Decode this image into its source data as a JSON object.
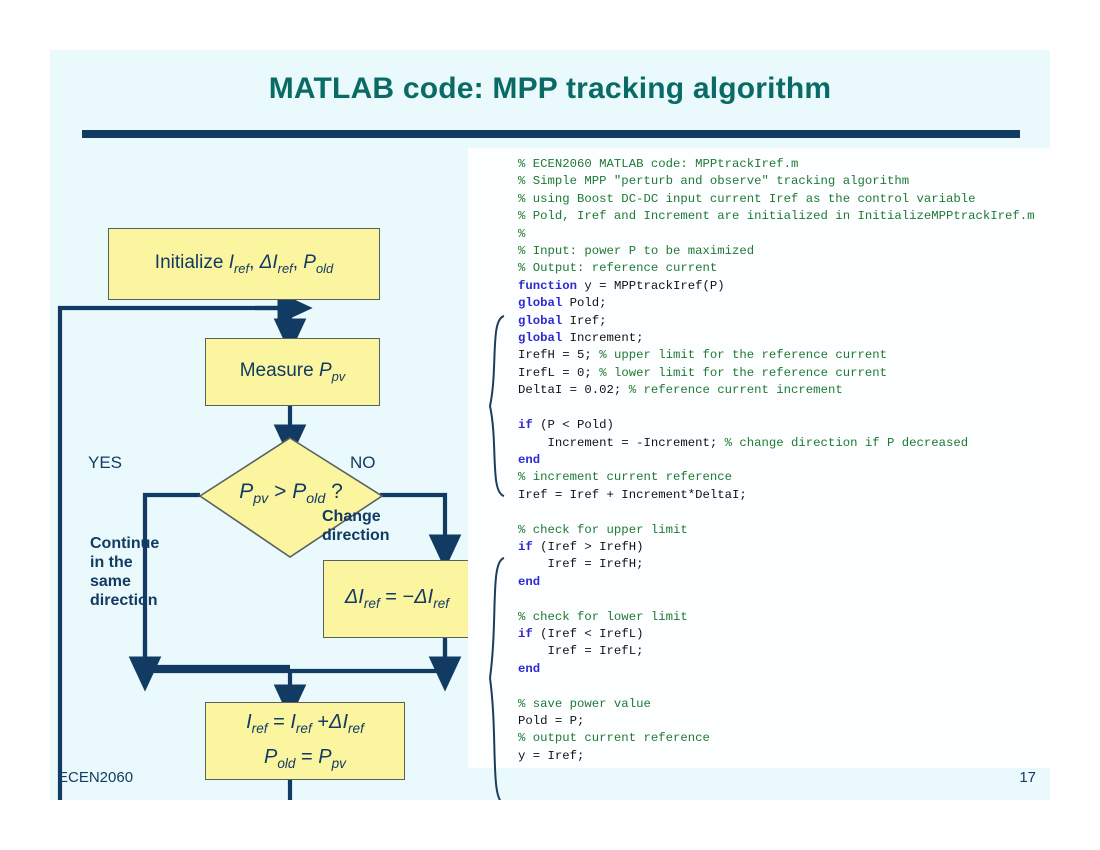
{
  "slide": {
    "title": "MATLAB code: MPP tracking algorithm",
    "footer_left": "ECEN2060",
    "footer_right": "17",
    "accent_title_color": "#0a6b66",
    "rule_color": "#123b63",
    "node_fill": "#fcf5a0",
    "arrow_color": "#123b63",
    "background": "#eafafc"
  },
  "flowchart": {
    "nodes": [
      {
        "name": "initialize",
        "text": "Initialize I ref, ΔI ref, P old",
        "parts": [
          "Initialize ",
          "I",
          "ref",
          ", ",
          "ΔI",
          "ref",
          ", ",
          "P",
          "old"
        ]
      },
      {
        "name": "measure",
        "text": "Measure P pv",
        "parts": [
          "Measure ",
          "P",
          "pv"
        ]
      },
      {
        "name": "decision",
        "text": "P pv > P old ?",
        "parts": [
          "P",
          "pv",
          " > ",
          "P",
          "old",
          " ?"
        ]
      },
      {
        "name": "negate",
        "text": "ΔI ref = −ΔI ref",
        "parts": [
          "ΔI",
          "ref",
          " = −ΔI",
          "ref"
        ]
      },
      {
        "name": "update_line1",
        "text": "I ref = I ref +ΔI ref",
        "parts": [
          "I",
          "ref",
          " = I",
          "ref",
          " +ΔI",
          "ref"
        ]
      },
      {
        "name": "update_line2",
        "text": "P old = P pv",
        "parts": [
          "P",
          "old",
          " = P",
          "pv"
        ]
      }
    ],
    "labels": {
      "yes": "YES",
      "no": "NO",
      "continue": "Continue\nin the\nsame\ndirection",
      "continue_lines": [
        "Continue",
        "in the",
        "same",
        "direction"
      ],
      "change": "Change\ndirection",
      "change_lines": [
        "Change",
        "direction"
      ]
    }
  },
  "code": {
    "lines": [
      [
        [
          "c-com",
          "% ECEN2060 MATLAB code: MPPtrackIref.m"
        ]
      ],
      [
        [
          "c-com",
          "% Simple MPP \"perturb and observe\" tracking algorithm"
        ]
      ],
      [
        [
          "c-com",
          "% using Boost DC-DC input current Iref as the control variable"
        ]
      ],
      [
        [
          "c-com",
          "% Pold, Iref and Increment are initialized in InitializeMPPtrackIref.m"
        ]
      ],
      [
        [
          "c-com",
          "%"
        ]
      ],
      [
        [
          "c-com",
          "% Input: power P to be maximized"
        ]
      ],
      [
        [
          "c-com",
          "% Output: reference current"
        ]
      ],
      [
        [
          "c-kw",
          "function"
        ],
        [
          "c-txt",
          " y = MPPtrackIref(P)"
        ]
      ],
      [
        [
          "c-kw",
          "global"
        ],
        [
          "c-txt",
          " Pold;"
        ]
      ],
      [
        [
          "c-kw",
          "global"
        ],
        [
          "c-txt",
          " Iref;"
        ]
      ],
      [
        [
          "c-kw",
          "global"
        ],
        [
          "c-txt",
          " Increment;"
        ]
      ],
      [
        [
          "c-txt",
          "IrefH = 5; "
        ],
        [
          "c-com",
          "% upper limit for the reference current"
        ]
      ],
      [
        [
          "c-txt",
          "IrefL = 0; "
        ],
        [
          "c-com",
          "% lower limit for the reference current"
        ]
      ],
      [
        [
          "c-txt",
          "DeltaI = 0.02; "
        ],
        [
          "c-com",
          "% reference current increment"
        ]
      ],
      [
        [
          "c-txt",
          ""
        ]
      ],
      [
        [
          "c-kw",
          "if"
        ],
        [
          "c-txt",
          " (P < Pold)"
        ]
      ],
      [
        [
          "c-txt",
          "    Increment = -Increment; "
        ],
        [
          "c-com",
          "% change direction if P decreased"
        ]
      ],
      [
        [
          "c-kw",
          "end"
        ]
      ],
      [
        [
          "c-com",
          "% increment current reference"
        ]
      ],
      [
        [
          "c-txt",
          "Iref = Iref + Increment*DeltaI;"
        ]
      ],
      [
        [
          "c-txt",
          ""
        ]
      ],
      [
        [
          "c-com",
          "% check for upper limit"
        ]
      ],
      [
        [
          "c-kw",
          "if"
        ],
        [
          "c-txt",
          " (Iref > IrefH)"
        ]
      ],
      [
        [
          "c-txt",
          "    Iref = IrefH;"
        ]
      ],
      [
        [
          "c-kw",
          "end"
        ]
      ],
      [
        [
          "c-txt",
          ""
        ]
      ],
      [
        [
          "c-com",
          "% check for lower limit"
        ]
      ],
      [
        [
          "c-kw",
          "if"
        ],
        [
          "c-txt",
          " (Iref < IrefL)"
        ]
      ],
      [
        [
          "c-txt",
          "    Iref = IrefL;"
        ]
      ],
      [
        [
          "c-kw",
          "end"
        ]
      ],
      [
        [
          "c-txt",
          ""
        ]
      ],
      [
        [
          "c-com",
          "% save power value"
        ]
      ],
      [
        [
          "c-txt",
          "Pold = P;"
        ]
      ],
      [
        [
          "c-com",
          "% output current reference"
        ]
      ],
      [
        [
          "c-txt",
          "y = Iref;"
        ]
      ]
    ]
  }
}
